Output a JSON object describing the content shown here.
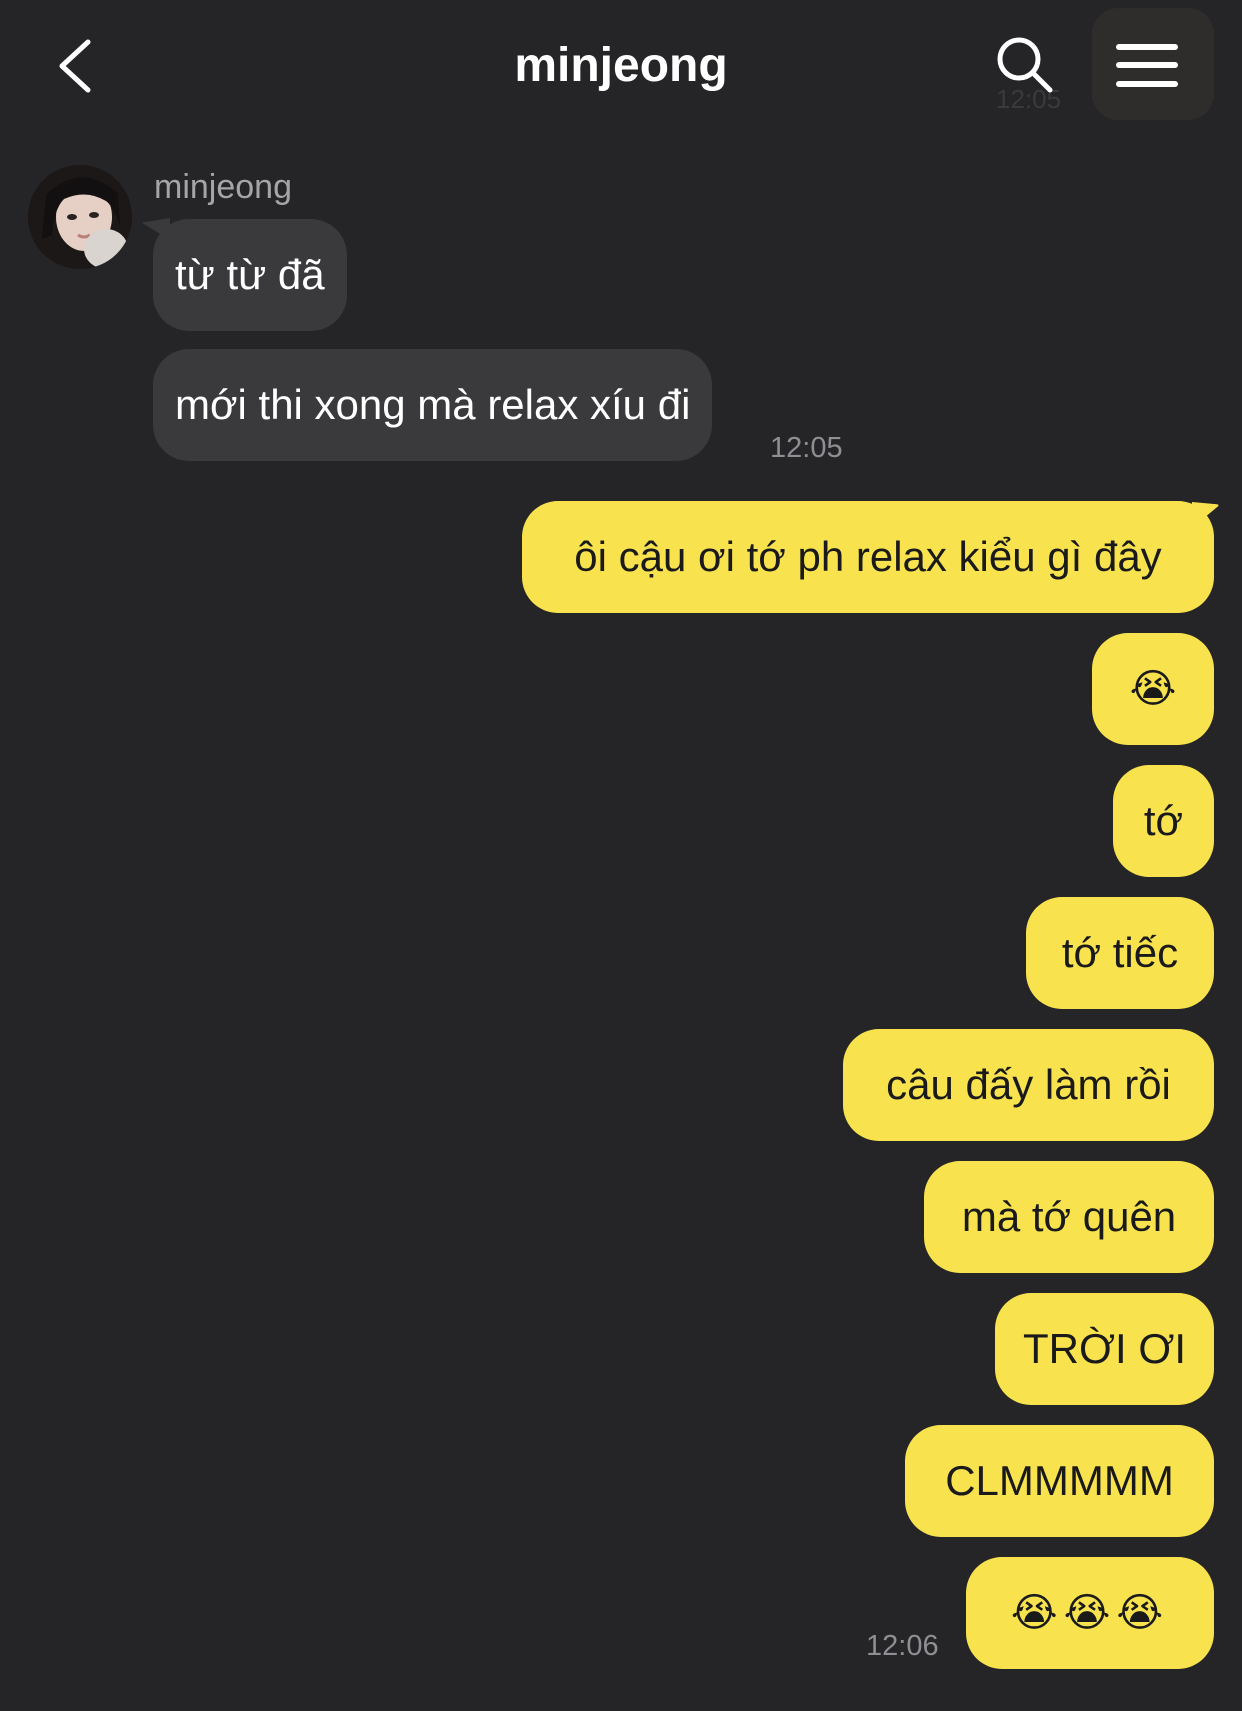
{
  "header": {
    "title": "minjeong",
    "back_icon": "chevron-left-icon",
    "search_icon": "search-icon",
    "menu_icon": "hamburger-menu-icon",
    "ghost_time": "12:05"
  },
  "colors": {
    "background": "#252527",
    "incoming_bubble": "#3a3a3c",
    "outgoing_bubble": "#f8e34e",
    "timestamp": "#8e8e93"
  },
  "conversation": {
    "incoming": {
      "sender": "minjeong",
      "messages": [
        "từ từ đã",
        "mới thi xong mà relax xíu đi"
      ],
      "time": "12:05"
    },
    "outgoing": {
      "messages": [
        "ôi cậu ơi tớ ph relax kiểu gì đây",
        "😭",
        "tớ",
        "tớ tiếc",
        "câu đấy làm rồi",
        "mà tớ quên",
        "TRỜI ƠI",
        "CLMMMMM",
        "😭😭😭"
      ],
      "time": "12:06"
    }
  }
}
